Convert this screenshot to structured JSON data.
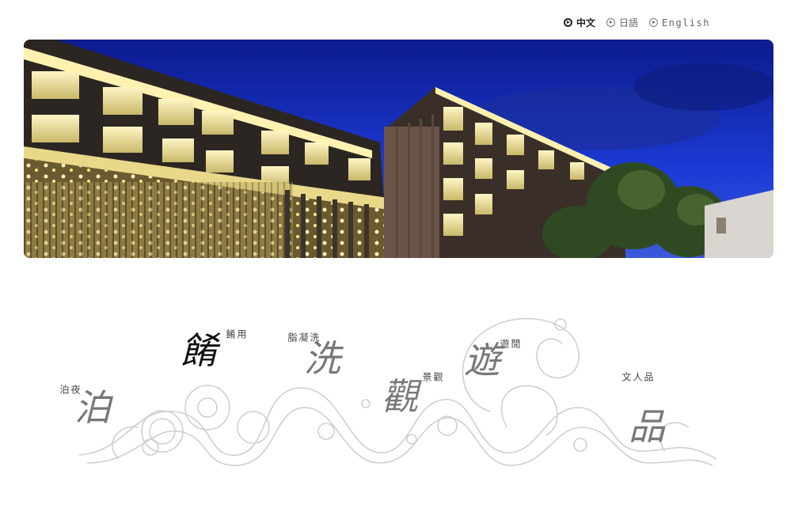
{
  "language_bar": {
    "items": [
      {
        "label": "中文",
        "active": true
      },
      {
        "label": "日語",
        "active": false
      },
      {
        "label": "English",
        "active": false
      }
    ]
  },
  "hero": {
    "description_colors": {
      "sky": "#1c3bd6",
      "sky_top": "#0c1a8c",
      "light": "#f3e7a0",
      "building": "#2b2622"
    }
  },
  "nav": {
    "items": [
      {
        "key": "stay",
        "label": "夜泊",
        "glyph": "泊",
        "glyph_color": "#777"
      },
      {
        "key": "dining",
        "label": "用餚",
        "glyph": "餚",
        "glyph_color": "#111"
      },
      {
        "key": "spa",
        "label": "洗凝脂",
        "glyph": "洗",
        "glyph_color": "#777"
      },
      {
        "key": "view",
        "label": "觀景",
        "glyph": "觀",
        "glyph_color": "#777"
      },
      {
        "key": "leisure",
        "label": "閒遊",
        "glyph": "遊",
        "glyph_color": "#777"
      },
      {
        "key": "culture",
        "label": "品人文",
        "glyph": "品",
        "glyph_color": "#777"
      }
    ]
  }
}
